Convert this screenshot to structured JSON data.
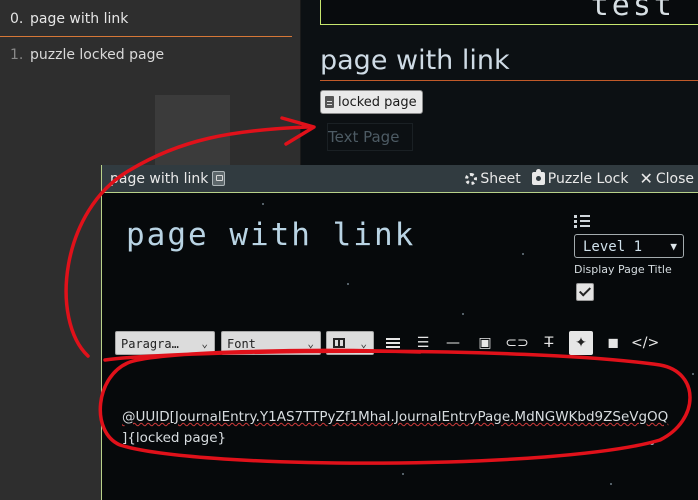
{
  "sidebar": {
    "items": [
      {
        "number": "0.",
        "label": "page with link",
        "active": true
      },
      {
        "number": "1.",
        "label": "puzzle locked page",
        "active": false
      }
    ]
  },
  "upper_sheet": {
    "banner_text": "test",
    "page_title": "page with link",
    "link_label": "locked page",
    "tab_label": "Text Page"
  },
  "window": {
    "title": "page with link",
    "actions": {
      "sheet": "Sheet",
      "puzzle_lock": "Puzzle Lock",
      "close": "Close"
    },
    "page_title_input": "page with link",
    "level_select": "Level 1",
    "display_page_title_label": "Display Page Title",
    "display_page_title_checked": true,
    "toolbar": {
      "paragraph": "Paragra…",
      "font": "Font"
    },
    "editor_content": {
      "line1": "@UUID[JournalEntry.Y1AS7TTPyZf1MhaI.JournalEntryPage.MdNGWKbd9ZSeVgOQ",
      "line2": "]{locked page}"
    }
  },
  "colors": {
    "accent_green": "#c7e66e",
    "accent_orange": "#d67737",
    "annotation_red": "#e0111a"
  }
}
